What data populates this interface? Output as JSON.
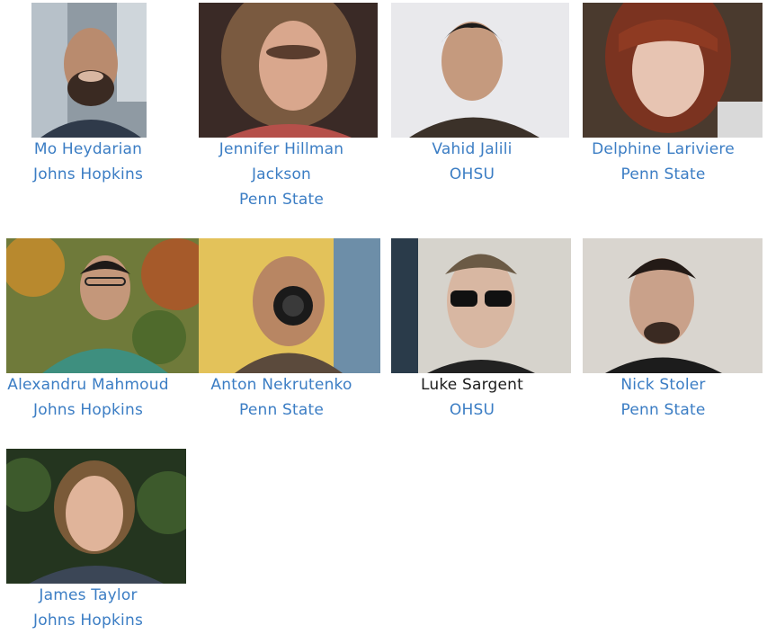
{
  "people": [
    {
      "name": "Mo Heydarian",
      "affiliations": [
        "Johns Hopkins"
      ],
      "name_is_link": true,
      "photo": "portrait-photo"
    },
    {
      "name": "Jennifer Hillman",
      "affiliations": [
        "Jackson",
        "Penn State"
      ],
      "name_is_link": true,
      "photo": "portrait-photo"
    },
    {
      "name": "Vahid Jalili",
      "affiliations": [
        "OHSU"
      ],
      "name_is_link": true,
      "photo": "portrait-photo"
    },
    {
      "name": "Delphine Lariviere",
      "affiliations": [
        "Penn State"
      ],
      "name_is_link": true,
      "photo": "portrait-photo"
    },
    {
      "name": "Alexandru Mahmoud",
      "affiliations": [
        "Johns Hopkins"
      ],
      "name_is_link": true,
      "photo": "portrait-photo"
    },
    {
      "name": "Anton Nekrutenko",
      "affiliations": [
        "Penn State"
      ],
      "name_is_link": true,
      "photo": "portrait-photo"
    },
    {
      "name": "Luke Sargent",
      "affiliations": [
        "OHSU"
      ],
      "name_is_link": false,
      "photo": "portrait-photo"
    },
    {
      "name": "Nick Stoler",
      "affiliations": [
        "Penn State"
      ],
      "name_is_link": true,
      "photo": "portrait-photo"
    },
    {
      "name": "James Taylor",
      "affiliations": [
        "Johns Hopkins"
      ],
      "name_is_link": true,
      "photo": "portrait-photo"
    }
  ],
  "colors": {
    "link": "#3b7dc4",
    "text": "#1c1c1c",
    "background": "#ffffff"
  }
}
